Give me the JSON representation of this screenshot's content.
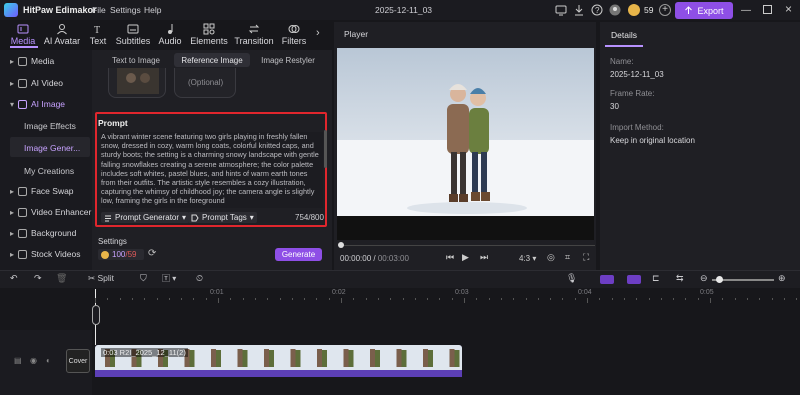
{
  "titlebar": {
    "app_title": "HitPaw Edimakor",
    "menus": [
      "File",
      "Settings",
      "Help"
    ],
    "project_name": "2025-12-11_03",
    "credits": "59",
    "export_label": "Export"
  },
  "top_tabs": [
    "Media",
    "AI Avatar",
    "Text",
    "Subtitles",
    "Audio",
    "Elements",
    "Transition",
    "Filters"
  ],
  "sidebar": {
    "items": [
      "Media",
      "AI Video",
      "AI Image",
      "Face Swap",
      "Video Enhancer",
      "Background",
      "Stock Videos"
    ],
    "sub_items": [
      "Image Effects",
      "Image Gener...",
      "My Creations"
    ]
  },
  "ai_image": {
    "segment_tabs": [
      "Text to Image",
      "Reference Image",
      "Image Restyler"
    ],
    "optional_label": "(Optional)",
    "prompt_label": "Prompt",
    "prompt_text": "A vibrant winter scene featuring two girls playing in freshly fallen snow, dressed in cozy, warm long coats, colorful knitted caps, and sturdy boots; the setting is a charming snowy landscape with gentle falling snowflakes creating a serene atmosphere; the color palette includes soft whites, pastel blues, and hints of warm earth tones from their outfits. The artistic style resembles a cozy illustration, capturing the whimsy of childhood joy; the camera angle is slightly low, framing the girls in the foreground",
    "prompt_generator_label": "Prompt Generator",
    "prompt_tags_label": "Prompt Tags",
    "char_count": "754/800",
    "settings_label": "Settings",
    "credits_cost": "100",
    "credits_total": "/59",
    "generate_label": "Generate"
  },
  "player": {
    "title": "Player",
    "current_time": "00:00:00",
    "total_time": "00:03:00",
    "aspect": "4:3"
  },
  "details": {
    "tab": "Details",
    "name_label": "Name:",
    "name_value": "2025-12-11_03",
    "frame_rate_label": "Frame Rate:",
    "frame_rate_value": "30",
    "import_label": "Import Method:",
    "import_value": "Keep in original location"
  },
  "timeline": {
    "split_label": "Split",
    "ruler": [
      "0:01",
      "0:02",
      "0:03",
      "0:04",
      "0:05"
    ],
    "cover_label": "Cover",
    "clip_label": "0:03  R2I_2025_12_11(2)"
  },
  "colors": {
    "accent": "#8e4fe6",
    "highlight": "#e0262d",
    "active_text": "#b892ff"
  }
}
